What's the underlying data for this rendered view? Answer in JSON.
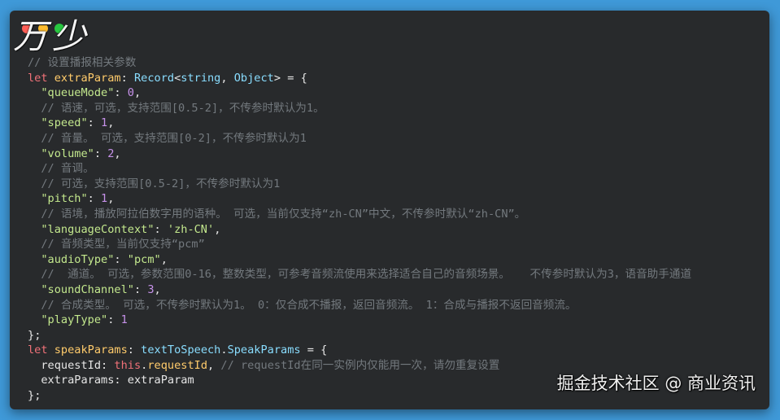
{
  "window": {
    "watermark_logo": "万少",
    "footer_watermark": "掘金技术社区 @ 商业资讯"
  },
  "code": [
    "// 设置播报相关参数",
    "let extraParam: Record<string, Object> = {",
    "  \"queueMode\": 0,",
    "  // 语速，可选，支持范围[0.5-2]，不传参时默认为1。",
    "  \"speed\": 1,",
    "  // 音量。 可选，支持范围[0-2]，不传参时默认为1",
    "  \"volume\": 2,",
    "  // 音调。",
    "  // 可选，支持范围[0.5-2]，不传参时默认为1",
    "  \"pitch\": 1,",
    "  // 语境，播放阿拉伯数字用的语种。 可选，当前仅支持“zh-CN”中文，不传参时默认“zh-CN”。",
    "  \"languageContext\": 'zh-CN',",
    "  // 音频类型，当前仅支持“pcm”",
    "  \"audioType\": \"pcm\",",
    "  //  通道。 可选，参数范围0-16，整数类型，可参考音频流使用来选择适合自己的音频场景。   不传参时默认为3，语音助手通道",
    "  \"soundChannel\": 3,",
    "  // 合成类型。 可选，不传参时默认为1。 0：仅合成不播报，返回音频流。 1：合成与播报不返回音频流。",
    "  \"playType\": 1",
    "};",
    "let speakParams: textToSpeech.SpeakParams = {",
    "  requestId: this.requestId, // requestId在同一实例内仅能用一次，请勿重复设置",
    "  extraParams: extraParam",
    "};"
  ]
}
